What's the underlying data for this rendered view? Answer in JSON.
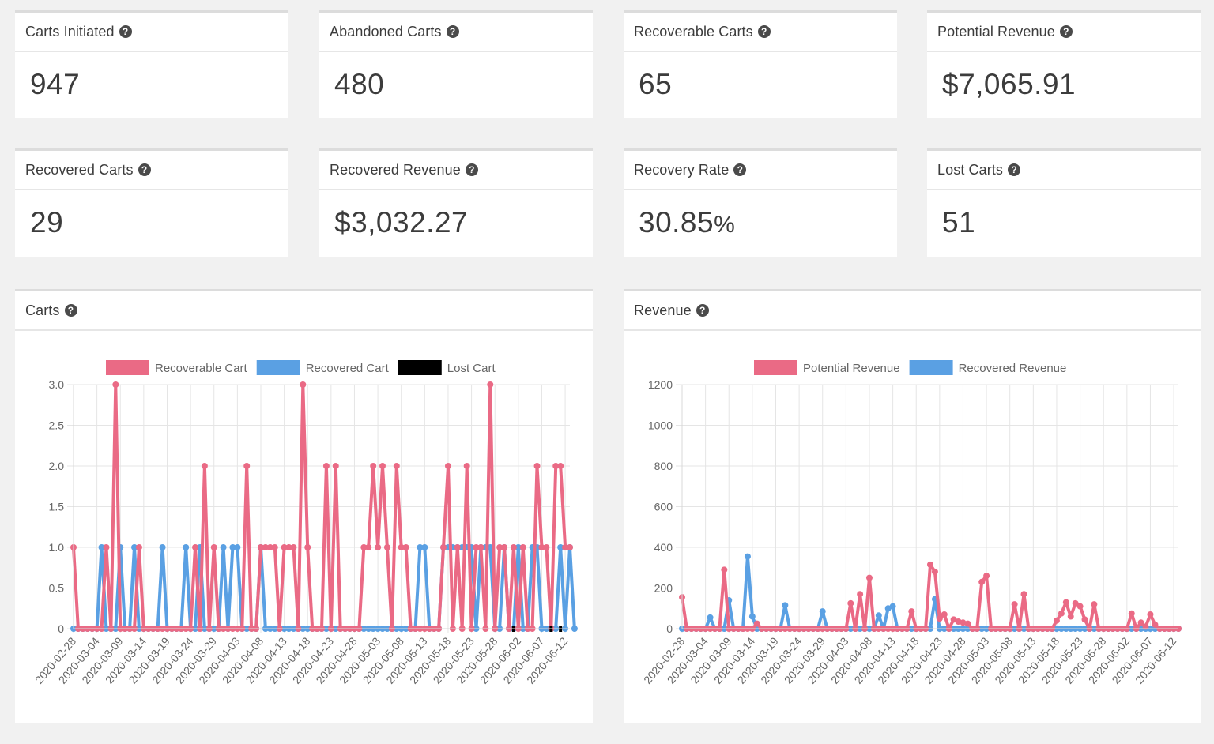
{
  "stats": [
    {
      "label": "Carts Initiated",
      "value": "947"
    },
    {
      "label": "Abandoned Carts",
      "value": "480"
    },
    {
      "label": "Recoverable Carts",
      "value": "65"
    },
    {
      "label": "Potential Revenue",
      "value": "$7,065.91"
    },
    {
      "label": "Recovered Carts",
      "value": "29"
    },
    {
      "label": "Recovered Revenue",
      "value": "$3,032.27"
    },
    {
      "label": "Recovery Rate",
      "value": "30.85",
      "suffix": "%"
    },
    {
      "label": "Lost Carts",
      "value": "51"
    }
  ],
  "help_icon": "question-circle-icon",
  "colors": {
    "pink": "#ea6a85",
    "blue": "#5aa0e3",
    "black": "#000000"
  },
  "chart_data": [
    {
      "type": "line",
      "title": "Carts",
      "legend_position": "top",
      "xlabel": "",
      "ylabel": "",
      "ylim": [
        0,
        3
      ],
      "yticks": [
        "0",
        "0.5",
        "1.0",
        "1.5",
        "2.0",
        "2.5",
        "3.0"
      ],
      "ytick_values": [
        0,
        0.5,
        1,
        1.5,
        2,
        2.5,
        3
      ],
      "start_date": "2020-02-28",
      "end_date": "2020-06-12",
      "xtick_labels": [
        "2020-02-28",
        "2020-03-04",
        "2020-03-09",
        "2020-03-14",
        "2020-03-19",
        "2020-03-24",
        "2020-03-29",
        "2020-04-03",
        "2020-04-08",
        "2020-04-13",
        "2020-04-18",
        "2020-04-23",
        "2020-04-28",
        "2020-05-03",
        "2020-05-08",
        "2020-05-13",
        "2020-05-18",
        "2020-05-23",
        "2020-05-28",
        "2020-06-02",
        "2020-06-07",
        "2020-06-12"
      ],
      "grid": true,
      "series": [
        {
          "name": "Recoverable Cart",
          "color": "#ea6a85",
          "values": [
            1,
            0,
            0,
            0,
            0,
            0,
            0,
            1,
            0,
            3,
            0,
            0,
            0,
            0,
            1,
            0,
            0,
            0,
            0,
            0,
            0,
            0,
            0,
            0,
            0,
            0,
            1,
            0,
            2,
            0,
            1,
            0,
            0,
            0,
            0,
            0,
            0,
            2,
            0,
            0,
            1,
            1,
            1,
            1,
            0,
            1,
            1,
            1,
            0,
            3,
            1,
            0,
            0,
            0,
            2,
            0,
            2,
            0,
            0,
            0,
            0,
            0,
            1,
            1,
            2,
            1,
            2,
            1,
            0,
            2,
            1,
            1,
            0,
            0,
            0,
            0,
            0,
            0,
            0,
            1,
            2,
            0,
            1,
            0,
            2,
            0,
            1,
            1,
            0,
            3,
            0,
            1,
            1,
            0,
            1,
            0,
            1,
            0,
            0,
            2,
            1,
            1,
            0,
            2,
            2,
            1,
            1
          ]
        },
        {
          "name": "Recovered Cart",
          "color": "#5aa0e3",
          "values": [
            0,
            0,
            0,
            0,
            0,
            0,
            1,
            0,
            0,
            0,
            1,
            0,
            0,
            1,
            0,
            0,
            0,
            0,
            0,
            1,
            0,
            0,
            0,
            0,
            1,
            0,
            0,
            1,
            0,
            0,
            0,
            0,
            1,
            0,
            1,
            1,
            0,
            0,
            0,
            0,
            1,
            0,
            0,
            0,
            0,
            0,
            0,
            0,
            0,
            0,
            0,
            0,
            0,
            0,
            0,
            0,
            0,
            0,
            0,
            0,
            0,
            0,
            0,
            0,
            0,
            0,
            0,
            0,
            0,
            0,
            0,
            0,
            0,
            0,
            1,
            1,
            0,
            0,
            0,
            1,
            1,
            1,
            1,
            1,
            1,
            1,
            0,
            1,
            1,
            1,
            0,
            0,
            1,
            0,
            0,
            1,
            0,
            0,
            1,
            1,
            0,
            0,
            0,
            0,
            1,
            0,
            1,
            0
          ]
        },
        {
          "name": "Lost Cart",
          "color": "#000000",
          "values": [
            0,
            0,
            0,
            0,
            0,
            0,
            0,
            0,
            0,
            0,
            0,
            0,
            0,
            0,
            0,
            0,
            0,
            0,
            0,
            0,
            0,
            0,
            0,
            0,
            0,
            0,
            0,
            0,
            0,
            0,
            0,
            0,
            0,
            0,
            0,
            0,
            0,
            0,
            0,
            0,
            0,
            0,
            0,
            0,
            0,
            0,
            0,
            0,
            0,
            0,
            0,
            0,
            0,
            0,
            0,
            0,
            0,
            0,
            0,
            0,
            0,
            0,
            0,
            0,
            0,
            0,
            0,
            0,
            0,
            0,
            0,
            0,
            0,
            0,
            0,
            0,
            0,
            0,
            0,
            0,
            0,
            0,
            0,
            0,
            0,
            0,
            0,
            0,
            0,
            0,
            0,
            0,
            0,
            0,
            0,
            0,
            0,
            0,
            0,
            0,
            0,
            0,
            0,
            0,
            0,
            0,
            0
          ]
        }
      ]
    },
    {
      "type": "line",
      "title": "Revenue",
      "legend_position": "top",
      "xlabel": "",
      "ylabel": "",
      "ylim": [
        0,
        1200
      ],
      "yticks": [
        "0",
        "200",
        "400",
        "600",
        "800",
        "1000",
        "1200"
      ],
      "ytick_values": [
        0,
        200,
        400,
        600,
        800,
        1000,
        1200
      ],
      "start_date": "2020-02-28",
      "end_date": "2020-06-12",
      "xtick_labels": [
        "2020-02-28",
        "2020-03-04",
        "2020-03-09",
        "2020-03-14",
        "2020-03-19",
        "2020-03-24",
        "2020-03-29",
        "2020-04-03",
        "2020-04-08",
        "2020-04-13",
        "2020-04-18",
        "2020-04-23",
        "2020-04-28",
        "2020-05-03",
        "2020-05-08",
        "2020-05-13",
        "2020-05-18",
        "2020-05-23",
        "2020-05-28",
        "2020-06-02",
        "2020-06-07",
        "2020-06-12"
      ],
      "grid": true,
      "series": [
        {
          "name": "Potential Revenue",
          "color": "#ea6a85",
          "values": [
            155,
            0,
            0,
            0,
            0,
            0,
            0,
            0,
            0,
            290,
            0,
            0,
            0,
            0,
            0,
            0,
            25,
            0,
            0,
            0,
            0,
            0,
            0,
            0,
            0,
            0,
            0,
            0,
            0,
            0,
            0,
            0,
            0,
            0,
            0,
            0,
            125,
            0,
            170,
            0,
            250,
            0,
            0,
            0,
            0,
            0,
            0,
            0,
            0,
            85,
            0,
            0,
            0,
            315,
            280,
            50,
            70,
            0,
            45,
            35,
            30,
            25,
            0,
            0,
            230,
            260,
            0,
            0,
            0,
            0,
            0,
            120,
            0,
            170,
            0,
            0,
            0,
            0,
            0,
            0,
            40,
            75,
            130,
            60,
            125,
            110,
            45,
            0,
            120,
            0,
            0,
            0,
            0,
            0,
            0,
            0,
            75,
            0,
            30,
            10,
            70,
            20,
            0,
            0,
            0,
            0,
            0
          ]
        },
        {
          "name": "Recovered Revenue",
          "color": "#5aa0e3",
          "values": [
            0,
            0,
            0,
            0,
            0,
            0,
            55,
            0,
            0,
            0,
            140,
            0,
            0,
            0,
            355,
            60,
            0,
            0,
            0,
            0,
            0,
            0,
            115,
            0,
            0,
            0,
            0,
            0,
            0,
            0,
            85,
            0,
            0,
            0,
            0,
            0,
            0,
            0,
            0,
            0,
            0,
            0,
            65,
            0,
            100,
            110,
            0,
            0,
            0,
            0,
            0,
            0,
            0,
            0,
            145,
            0,
            0,
            0,
            0,
            0,
            0,
            0,
            0,
            0,
            0,
            0,
            0,
            0,
            0,
            0,
            0,
            0,
            0,
            0,
            0,
            0,
            0,
            0,
            0,
            0,
            0,
            0,
            0,
            0,
            0,
            0,
            0,
            0,
            0,
            0,
            0,
            0,
            0,
            0,
            0,
            0,
            0,
            0,
            0,
            0,
            0,
            0,
            0,
            0,
            0,
            0,
            0
          ]
        }
      ]
    }
  ]
}
